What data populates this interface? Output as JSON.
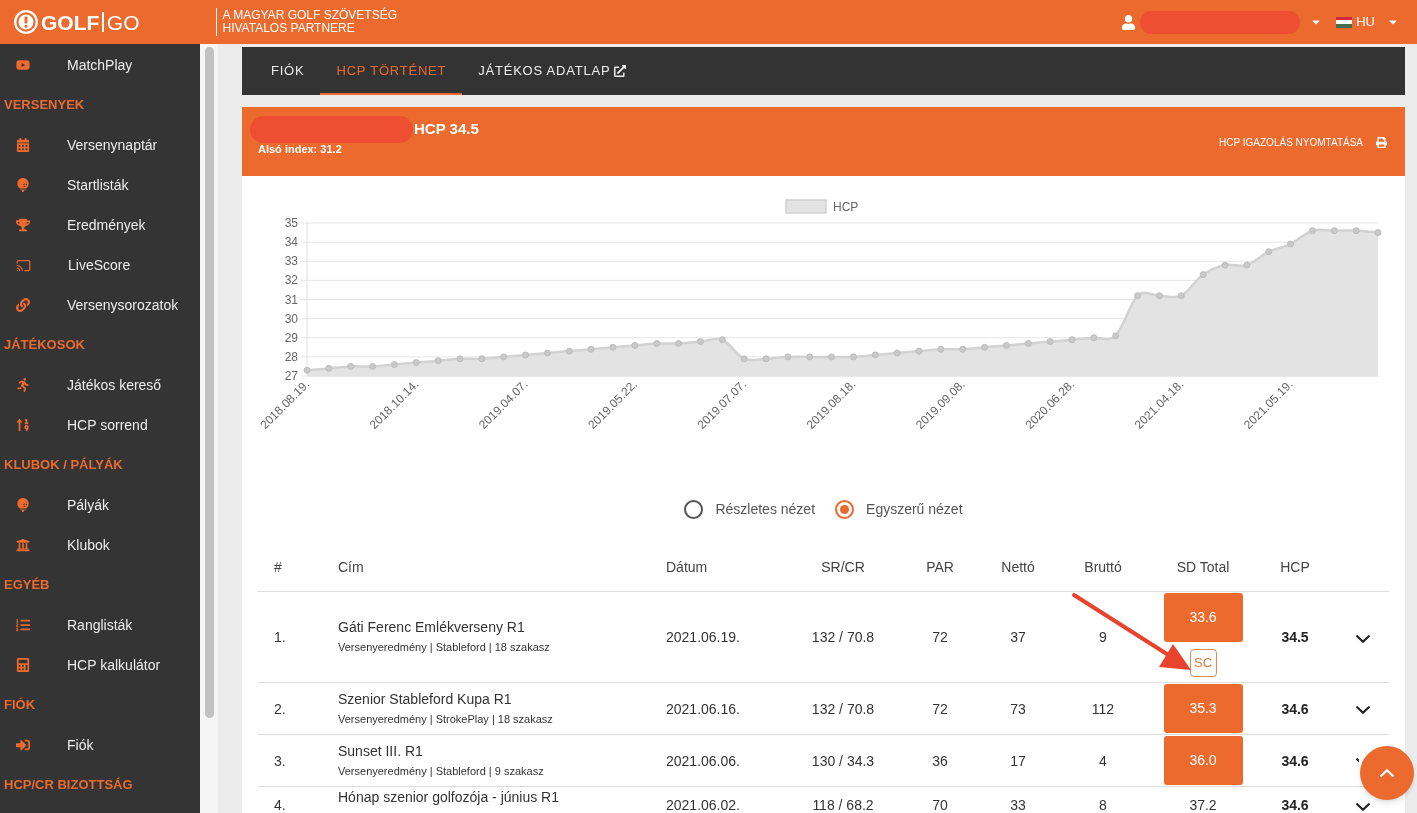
{
  "header": {
    "logo_bold": "GOLF",
    "logo_light": "GO",
    "partner_lines": [
      "A MAGYAR GOLF SZÖVETSÉG",
      "HIVATALOS PARTNERE"
    ],
    "language": "HU"
  },
  "sidebar": {
    "items": [
      {
        "kind": "link",
        "label": "MatchPlay"
      },
      {
        "kind": "section",
        "label": "VERSENYEK"
      },
      {
        "kind": "link",
        "label": "Versenynaptár"
      },
      {
        "kind": "link",
        "label": "Startlisták"
      },
      {
        "kind": "link",
        "label": "Eredmények"
      },
      {
        "kind": "link",
        "label": "LiveScore"
      },
      {
        "kind": "link",
        "label": "Versenysorozatok"
      },
      {
        "kind": "section",
        "label": "JÁTÉKOSOK"
      },
      {
        "kind": "link",
        "label": "Játékos kereső"
      },
      {
        "kind": "link",
        "label": "HCP sorrend"
      },
      {
        "kind": "section",
        "label": "KLUBOK / PÁLYÁK"
      },
      {
        "kind": "link",
        "label": "Pályák"
      },
      {
        "kind": "link",
        "label": "Klubok"
      },
      {
        "kind": "section",
        "label": "EGYÉB"
      },
      {
        "kind": "link",
        "label": "Ranglisták"
      },
      {
        "kind": "link",
        "label": "HCP kalkulátor"
      },
      {
        "kind": "section",
        "label": "FIÓK"
      },
      {
        "kind": "link",
        "label": "Fiók"
      },
      {
        "kind": "section",
        "label": "HCP/CR BIZOTTSÁG"
      }
    ]
  },
  "tabs": [
    {
      "label": "FIÓK",
      "selected": false,
      "external": false
    },
    {
      "label": "HCP TÖRTÉNET",
      "selected": true,
      "external": false
    },
    {
      "label": "JÁTÉKOS ADATLAP",
      "selected": false,
      "external": true
    }
  ],
  "player_card": {
    "hcp": "HCP 34.5",
    "lower_index": "Alsó index: 31.2",
    "print_link": "HCP IGAZOLÁS NYOMTATÁSA"
  },
  "chart": {
    "chart_data": {
      "type": "area",
      "series": [
        {
          "name": "HCP",
          "color": "#e3e3e3",
          "values": [
            27.3,
            27.4,
            27.5,
            27.5,
            27.6,
            27.7,
            27.8,
            27.9,
            27.9,
            28.0,
            28.1,
            28.2,
            28.3,
            28.4,
            28.5,
            28.6,
            28.7,
            28.7,
            28.8,
            28.9,
            27.9,
            27.9,
            28.0,
            28.0,
            28.0,
            28.0,
            28.1,
            28.2,
            28.3,
            28.4,
            28.4,
            28.5,
            28.6,
            28.7,
            28.8,
            28.9,
            29.0,
            29.1,
            31.2,
            31.2,
            31.2,
            32.3,
            32.8,
            32.8,
            33.5,
            33.9,
            34.6,
            34.6,
            34.6,
            34.5
          ]
        }
      ],
      "categories": [
        "2018.08.19.",
        null,
        null,
        null,
        null,
        "2018.10.14.",
        null,
        null,
        null,
        null,
        "2019.04.07.",
        null,
        null,
        null,
        null,
        "2019.05.22.",
        null,
        null,
        null,
        null,
        "2019.07.07.",
        null,
        null,
        null,
        null,
        "2019.08.18.",
        null,
        null,
        null,
        null,
        "2019.09.08.",
        null,
        null,
        null,
        null,
        "2020.06.28.",
        null,
        null,
        null,
        null,
        "2021.04.18.",
        null,
        null,
        null,
        null,
        "2021.05.19.",
        null,
        null,
        null,
        null
      ],
      "ylim": [
        27,
        35
      ],
      "yticks": [
        27,
        28,
        29,
        30,
        31,
        32,
        33,
        34,
        35
      ],
      "grid": true
    }
  },
  "view_options": [
    {
      "label": "Részletes nézet",
      "selected": false
    },
    {
      "label": "Egyszerű nézet",
      "selected": true
    }
  ],
  "table": {
    "columns": [
      "#",
      "Cím",
      "Dátum",
      "SR/CR",
      "PAR",
      "Nettó",
      "Bruttó",
      "SD Total",
      "HCP"
    ],
    "rows": [
      {
        "number": "1.",
        "title": "Gáti Ferenc Emlékverseny R1",
        "subtitle": "Versenyeredmény | Stableford | 18 szakasz",
        "date": "2021.06.19.",
        "sr_cr": "132 / 70.8",
        "par": "72",
        "netto": "37",
        "brutto": "9",
        "sd_total": "33.6",
        "highlighted": true,
        "badge": "SC",
        "hcp": "34.5"
      },
      {
        "number": "2.",
        "title": "Szenior Stableford Kupa R1",
        "subtitle": "Versenyeredmény | StrokePlay | 18 szakasz",
        "date": "2021.06.16.",
        "sr_cr": "132 / 70.8",
        "par": "72",
        "netto": "73",
        "brutto": "112",
        "sd_total": "35.3",
        "highlighted": true,
        "hcp": "34.6"
      },
      {
        "number": "3.",
        "title": "Sunset III. R1",
        "subtitle": "Versenyeredmény | Stableford | 9 szakasz",
        "date": "2021.06.06.",
        "sr_cr": "130 / 34.3",
        "par": "36",
        "netto": "17",
        "brutto": "4",
        "sd_total": "36.0",
        "highlighted": true,
        "hcp": "34.6"
      },
      {
        "number": "4.",
        "title": "Hónap szenior golfozója - június R1",
        "date": "2021.06.02.",
        "sr_cr": "118 / 68.2",
        "par": "70",
        "netto": "33",
        "brutto": "8",
        "sd_total": "37.2",
        "highlighted": false,
        "hcp": "34.6"
      }
    ]
  }
}
